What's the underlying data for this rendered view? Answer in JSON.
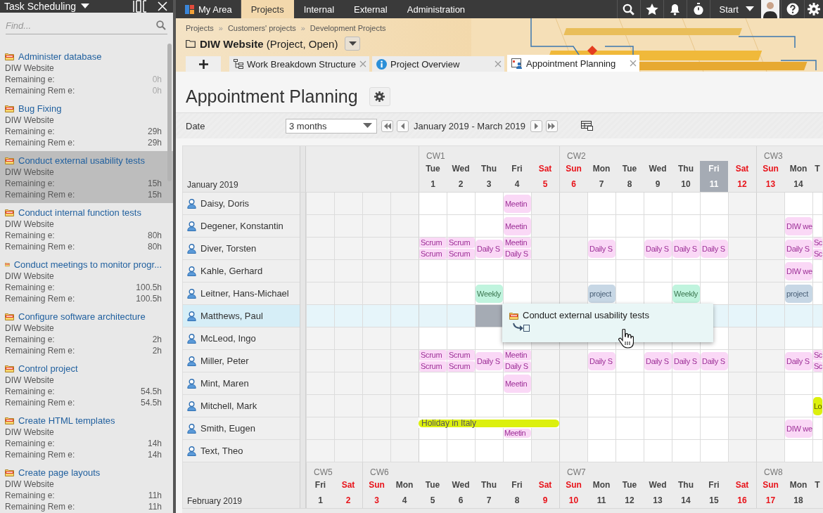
{
  "panel": {
    "title": "Task Scheduling",
    "search": {
      "placeholder": "Find..."
    },
    "tasks": [
      {
        "title": "Administer database",
        "project": "DIW Website",
        "selected": false,
        "dimmed": true,
        "lines": [
          {
            "label": "Remaining e:",
            "value": "0h"
          },
          {
            "label": "Remaining Rem e:",
            "value": "0h"
          }
        ]
      },
      {
        "title": "Bug Fixing",
        "project": "DIW Website",
        "selected": false,
        "dimmed": false,
        "lines": [
          {
            "label": "Remaining e:",
            "value": "29h"
          },
          {
            "label": "Remaining Rem e:",
            "value": "29h"
          }
        ]
      },
      {
        "title": "Conduct external usability tests",
        "project": "DIW Website",
        "selected": true,
        "dimmed": false,
        "lines": [
          {
            "label": "Remaining e:",
            "value": "15h"
          },
          {
            "label": "Remaining Rem e:",
            "value": "15h"
          }
        ]
      },
      {
        "title": "Conduct internal function tests",
        "project": "DIW Website",
        "selected": false,
        "dimmed": false,
        "lines": [
          {
            "label": "Remaining e:",
            "value": "80h"
          },
          {
            "label": "Remaining Rem e:",
            "value": "80h"
          }
        ]
      },
      {
        "title": "Conduct meetings to monitor progr...",
        "project": "DIW Website",
        "selected": false,
        "dimmed": false,
        "lines": [
          {
            "label": "Remaining e:",
            "value": "100.5h"
          },
          {
            "label": "Remaining Rem e:",
            "value": "100.5h"
          }
        ]
      },
      {
        "title": "Configure software architecture",
        "project": "DIW Website",
        "selected": false,
        "dimmed": false,
        "lines": [
          {
            "label": "Remaining e:",
            "value": "2h"
          },
          {
            "label": "Remaining Rem e:",
            "value": "2h"
          }
        ]
      },
      {
        "title": "Control project",
        "project": "DIW Website",
        "selected": false,
        "dimmed": false,
        "lines": [
          {
            "label": "Remaining e:",
            "value": "54.5h"
          },
          {
            "label": "Remaining Rem e:",
            "value": "54.5h"
          }
        ]
      },
      {
        "title": "Create HTML templates",
        "project": "DIW Website",
        "selected": false,
        "dimmed": false,
        "lines": [
          {
            "label": "Remaining e:",
            "value": "14h"
          },
          {
            "label": "Remaining Rem e:",
            "value": "14h"
          }
        ]
      },
      {
        "title": "Create page layouts",
        "project": "DIW Website",
        "selected": false,
        "dimmed": false,
        "lines": [
          {
            "label": "Remaining e:",
            "value": "11h"
          },
          {
            "label": "Remaining Rem e:",
            "value": "11h"
          }
        ]
      }
    ]
  },
  "nav": {
    "items": [
      {
        "label": "My Area",
        "kind": "home",
        "selected": false
      },
      {
        "label": "Projects",
        "kind": "tab",
        "selected": true
      },
      {
        "label": "Internal",
        "kind": "tab",
        "selected": false
      },
      {
        "label": "External",
        "kind": "tab",
        "selected": false
      },
      {
        "label": "Administration",
        "kind": "tab",
        "selected": false
      }
    ],
    "start": "Start"
  },
  "header": {
    "breadcrumb": [
      {
        "text": "Projects",
        "kind": "link"
      },
      {
        "text": "»",
        "kind": "separator"
      },
      {
        "text": "Customers' projects",
        "kind": "link"
      },
      {
        "text": "»",
        "kind": "separator"
      },
      {
        "text": "Development Projects",
        "kind": "link"
      }
    ],
    "title": "DIW Website",
    "status": "(Project, Open)",
    "tabs": [
      {
        "label": "Work Breakdown Structure",
        "kind": "wbs",
        "selected": false
      },
      {
        "label": "Project Overview",
        "kind": "info",
        "selected": false
      },
      {
        "label": "Appointment Planning",
        "kind": "planning",
        "selected": true
      }
    ]
  },
  "page": {
    "title": "Appointment Planning",
    "date_label": "Date",
    "range_select": "3 months",
    "range_text": "January 2019 - March 2019"
  },
  "calendar": {
    "months": [
      {
        "label": "January 2019",
        "days": [
          {
            "kind": "blank"
          },
          {
            "kind": "blank"
          },
          {
            "kind": "blank"
          },
          {
            "kind": "blank"
          },
          {
            "kind": "day",
            "week": "CW1",
            "name": "Tue",
            "num": "1",
            "weekend": false,
            "today": false
          },
          {
            "kind": "day",
            "name": "Wed",
            "num": "2",
            "weekend": false,
            "today": false
          },
          {
            "kind": "day",
            "name": "Thu",
            "num": "3",
            "weekend": false,
            "today": false
          },
          {
            "kind": "day",
            "name": "Fri",
            "num": "4",
            "weekend": false,
            "today": false
          },
          {
            "kind": "day",
            "name": "Sat",
            "num": "5",
            "weekend": true,
            "today": false
          },
          {
            "kind": "day",
            "week": "CW2",
            "name": "Sun",
            "num": "6",
            "weekend": true,
            "today": false
          },
          {
            "kind": "day",
            "name": "Mon",
            "num": "7",
            "weekend": false,
            "today": false
          },
          {
            "kind": "day",
            "name": "Tue",
            "num": "8",
            "weekend": false,
            "today": false
          },
          {
            "kind": "day",
            "name": "Wed",
            "num": "9",
            "weekend": false,
            "today": false
          },
          {
            "kind": "day",
            "name": "Thu",
            "num": "10",
            "weekend": false,
            "today": false
          },
          {
            "kind": "day",
            "name": "Fri",
            "num": "11",
            "weekend": false,
            "today": true
          },
          {
            "kind": "day",
            "name": "Sat",
            "num": "12",
            "weekend": true,
            "today": false
          },
          {
            "kind": "day",
            "week": "CW3",
            "name": "Sun",
            "num": "13",
            "weekend": true,
            "today": false
          },
          {
            "kind": "day",
            "name": "Mon",
            "num": "14",
            "weekend": false,
            "today": false
          },
          {
            "kind": "day",
            "name": "T",
            "weekend": false,
            "today": false
          }
        ],
        "rows": [
          {
            "name": "Daisy, Doris",
            "selected": false,
            "cells": [
              {},
              {},
              {},
              {
                "events": [
                  {
                    "text": "Meetin",
                    "kind": "meeting"
                  }
                ]
              },
              {},
              {},
              {},
              {},
              {},
              {},
              {},
              {},
              {},
              {},
              {}
            ]
          },
          {
            "name": "Degener, Konstantin",
            "selected": false,
            "cells": [
              {},
              {},
              {},
              {
                "events": [
                  {
                    "text": "Meetin",
                    "kind": "meeting"
                  }
                ]
              },
              {},
              {},
              {},
              {},
              {},
              {},
              {},
              {},
              {},
              {
                "events": [
                  {
                    "text": "DIW we",
                    "kind": "meeting"
                  }
                ]
              },
              {}
            ]
          },
          {
            "name": "Diver, Torsten",
            "selected": false,
            "cells": [
              {
                "events": [
                  {
                    "text": "Scrum",
                    "kind": "meeting"
                  },
                  {
                    "text": "Scrum",
                    "kind": "meeting"
                  }
                ]
              },
              {
                "events": [
                  {
                    "text": "Scrum",
                    "kind": "meeting"
                  },
                  {
                    "text": "Scrum",
                    "kind": "meeting"
                  }
                ]
              },
              {
                "events": [
                  {
                    "text": "Daily S",
                    "kind": "meeting"
                  }
                ]
              },
              {
                "events": [
                  {
                    "text": "Meetin",
                    "kind": "meeting"
                  },
                  {
                    "text": "Daily S",
                    "kind": "meeting"
                  }
                ]
              },
              {},
              {},
              {
                "events": [
                  {
                    "text": "Daily S",
                    "kind": "meeting"
                  }
                ]
              },
              {},
              {
                "events": [
                  {
                    "text": "Daily S",
                    "kind": "meeting"
                  }
                ]
              },
              {
                "events": [
                  {
                    "text": "Daily S",
                    "kind": "meeting"
                  }
                ]
              },
              {
                "events": [
                  {
                    "text": "Daily S",
                    "kind": "meeting"
                  }
                ]
              },
              {},
              {},
              {
                "events": [
                  {
                    "text": "Daily S",
                    "kind": "meeting"
                  }
                ]
              },
              {
                "events": [
                  {
                    "text": "Sc",
                    "kind": "meeting"
                  },
                  {
                    "text": "Sc",
                    "kind": "meeting"
                  }
                ]
              }
            ]
          },
          {
            "name": "Kahle, Gerhard",
            "selected": false,
            "cells": [
              {},
              {},
              {},
              {},
              {},
              {},
              {},
              {},
              {},
              {},
              {},
              {},
              {},
              {
                "events": [
                  {
                    "text": "DIW we",
                    "kind": "meeting"
                  }
                ]
              },
              {}
            ]
          },
          {
            "name": "Leitner, Hans-Michael",
            "selected": false,
            "cells": [
              {},
              {},
              {
                "events": [
                  {
                    "text": "Weekly",
                    "kind": "weekly"
                  }
                ]
              },
              {},
              {},
              {},
              {
                "events": [
                  {
                    "text": "project",
                    "kind": "project"
                  }
                ]
              },
              {},
              {},
              {
                "events": [
                  {
                    "text": "Weekly",
                    "kind": "weekly"
                  }
                ]
              },
              {},
              {},
              {},
              {
                "events": [
                  {
                    "text": "project",
                    "kind": "project"
                  }
                ]
              },
              {}
            ]
          },
          {
            "name": "Matthews, Paul",
            "selected": true,
            "cells": [
              {},
              {},
              {
                "drop_target": true
              },
              {},
              {},
              {},
              {},
              {},
              {},
              {},
              {},
              {},
              {},
              {},
              {}
            ]
          },
          {
            "name": "McLeod, Ingo",
            "selected": false,
            "cells": [
              {},
              {},
              {},
              {},
              {},
              {},
              {},
              {},
              {},
              {},
              {},
              {},
              {},
              {},
              {}
            ]
          },
          {
            "name": "Miller, Peter",
            "selected": false,
            "cells": [
              {
                "events": [
                  {
                    "text": "Scrum",
                    "kind": "meeting"
                  },
                  {
                    "text": "Scrum",
                    "kind": "meeting"
                  }
                ]
              },
              {
                "events": [
                  {
                    "text": "Scrum",
                    "kind": "meeting"
                  },
                  {
                    "text": "Scrum",
                    "kind": "meeting"
                  }
                ]
              },
              {
                "events": [
                  {
                    "text": "Daily S",
                    "kind": "meeting"
                  }
                ]
              },
              {
                "events": [
                  {
                    "text": "Meetin",
                    "kind": "meeting"
                  },
                  {
                    "text": "Daily S",
                    "kind": "meeting"
                  }
                ]
              },
              {},
              {},
              {
                "events": [
                  {
                    "text": "Daily S",
                    "kind": "meeting"
                  }
                ]
              },
              {},
              {
                "events": [
                  {
                    "text": "Daily S",
                    "kind": "meeting"
                  }
                ]
              },
              {
                "events": [
                  {
                    "text": "Daily S",
                    "kind": "meeting"
                  }
                ]
              },
              {
                "events": [
                  {
                    "text": "Daily S",
                    "kind": "meeting"
                  }
                ]
              },
              {},
              {},
              {
                "events": [
                  {
                    "text": "Daily S",
                    "kind": "meeting"
                  }
                ]
              },
              {
                "events": [
                  {
                    "text": "Sc",
                    "kind": "meeting"
                  },
                  {
                    "text": "Sc",
                    "kind": "meeting"
                  }
                ]
              }
            ]
          },
          {
            "name": "Mint, Maren",
            "selected": false,
            "cells": [
              {},
              {},
              {},
              {
                "events": [
                  {
                    "text": "Meetin",
                    "kind": "meeting"
                  }
                ]
              },
              {},
              {},
              {},
              {},
              {},
              {},
              {},
              {},
              {},
              {},
              {}
            ]
          },
          {
            "name": "Mitchell, Mark",
            "selected": false,
            "cells": [
              {},
              {},
              {},
              {},
              {},
              {},
              {},
              {},
              {},
              {},
              {},
              {},
              {},
              {},
              {
                "events": [
                  {
                    "text": "Lo",
                    "kind": "locale"
                  }
                ]
              }
            ]
          },
          {
            "name": "Smith, Eugen",
            "selected": false,
            "cells": [
              {
                "bar": {
                  "text": "Holiday in Italy",
                  "color": "#dcf00e"
                }
              },
              {
                "bar_continues": true
              },
              {
                "bar_continues": true
              },
              {
                "bar_continues": true,
                "events": [
                  {
                    "text": "Meetin",
                    "kind": "meeting"
                  }
                ]
              },
              {
                "bar_continues": true
              },
              {},
              {},
              {},
              {},
              {},
              {},
              {},
              {},
              {
                "events": [
                  {
                    "text": "DIW we",
                    "kind": "meeting"
                  }
                ]
              },
              {}
            ]
          },
          {
            "name": "Text, Theo",
            "selected": false,
            "cells": [
              {},
              {},
              {},
              {},
              {},
              {},
              {},
              {},
              {},
              {},
              {},
              {},
              {},
              {},
              {}
            ]
          }
        ]
      },
      {
        "label": "February 2019",
        "days": [
          {
            "kind": "day",
            "week": "CW5",
            "name": "Fri",
            "num": "1",
            "weekend": false,
            "today": false
          },
          {
            "kind": "day",
            "name": "Sat",
            "num": "2",
            "weekend": true,
            "today": false
          },
          {
            "kind": "day",
            "week": "CW6",
            "name": "Sun",
            "num": "3",
            "weekend": true,
            "today": false
          },
          {
            "kind": "day",
            "name": "Mon",
            "num": "4",
            "weekend": false,
            "today": false
          },
          {
            "kind": "day",
            "name": "Tue",
            "num": "5",
            "weekend": false,
            "today": false
          },
          {
            "kind": "day",
            "name": "Wed",
            "num": "6",
            "weekend": false,
            "today": false
          },
          {
            "kind": "day",
            "name": "Thu",
            "num": "7",
            "weekend": false,
            "today": false
          },
          {
            "kind": "day",
            "name": "Fri",
            "num": "8",
            "weekend": false,
            "today": false
          },
          {
            "kind": "day",
            "name": "Sat",
            "num": "9",
            "weekend": true,
            "today": false
          },
          {
            "kind": "day",
            "week": "CW7",
            "name": "Sun",
            "num": "10",
            "weekend": true,
            "today": false
          },
          {
            "kind": "day",
            "name": "Mon",
            "num": "11",
            "weekend": false,
            "today": false
          },
          {
            "kind": "day",
            "name": "Tue",
            "num": "12",
            "weekend": false,
            "today": false
          },
          {
            "kind": "day",
            "name": "Wed",
            "num": "13",
            "weekend": false,
            "today": false
          },
          {
            "kind": "day",
            "name": "Thu",
            "num": "14",
            "weekend": false,
            "today": false
          },
          {
            "kind": "day",
            "name": "Fri",
            "num": "15",
            "weekend": false,
            "today": false
          },
          {
            "kind": "day",
            "name": "Sat",
            "num": "16",
            "weekend": true,
            "today": false
          },
          {
            "kind": "day",
            "week": "CW8",
            "name": "Sun",
            "num": "17",
            "weekend": true,
            "today": false
          },
          {
            "kind": "day",
            "name": "Mon",
            "num": "18",
            "weekend": false,
            "today": false
          },
          {
            "kind": "day",
            "name": "T",
            "weekend": false,
            "today": false
          }
        ]
      }
    ],
    "drag_preview": {
      "text": "Conduct external usability tests"
    }
  }
}
